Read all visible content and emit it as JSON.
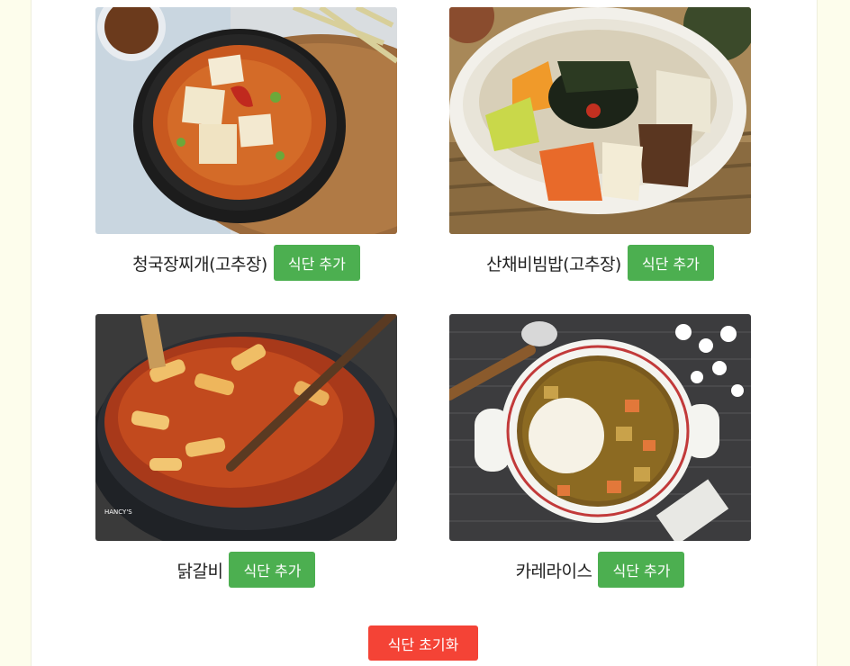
{
  "dishes": [
    {
      "name": "청국장찌개(고추장)",
      "button": "식단 추가",
      "image": "cheonggukjang-stew-photo"
    },
    {
      "name": "산채비빔밥(고추장)",
      "button": "식단 추가",
      "image": "sanchae-bibimbap-photo"
    },
    {
      "name": "닭갈비",
      "button": "식단 추가",
      "image": "dakgalbi-photo"
    },
    {
      "name": "카레라이스",
      "button": "식단 추가",
      "image": "curry-rice-photo"
    }
  ],
  "reset_button": "식단 초기화",
  "colors": {
    "page_bg": "#fdfdec",
    "panel_bg": "#ffffff",
    "add_button": "#4caf50",
    "reset_button": "#f44336"
  }
}
